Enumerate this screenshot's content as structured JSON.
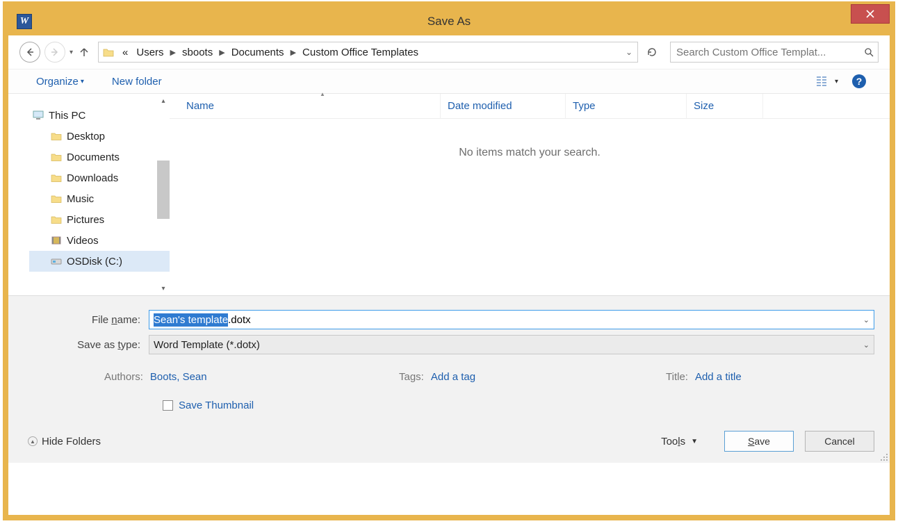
{
  "title": "Save As",
  "breadcrumbs": {
    "prefix": "«",
    "b0": "Users",
    "b1": "sboots",
    "b2": "Documents",
    "b3": "Custom Office Templates"
  },
  "search": {
    "placeholder": "Search Custom Office Templat..."
  },
  "toolbar": {
    "organize": "Organize",
    "newfolder": "New folder"
  },
  "tree": {
    "thispc": "This PC",
    "desktop": "Desktop",
    "documents": "Documents",
    "downloads": "Downloads",
    "music": "Music",
    "pictures": "Pictures",
    "videos": "Videos",
    "osdisk": "OSDisk (C:)"
  },
  "columns": {
    "name": "Name",
    "date": "Date modified",
    "type": "Type",
    "size": "Size"
  },
  "empty_msg": "No items match your search.",
  "labels": {
    "filename": "File name:",
    "saveastype": "Save as type:"
  },
  "filename": {
    "selected": "Sean's template",
    "suffix": ".dotx"
  },
  "saveas": "Word Template (*.dotx)",
  "meta": {
    "authors_k": "Authors:",
    "authors_v": "Boots, Sean",
    "tags_k": "Tags:",
    "tags_v": "Add a tag",
    "title_k": "Title:",
    "title_v": "Add a title"
  },
  "thumb": "Save Thumbnail",
  "hidefolders": "Hide Folders",
  "tools": "Tools",
  "save": "Save",
  "cancel": "Cancel"
}
